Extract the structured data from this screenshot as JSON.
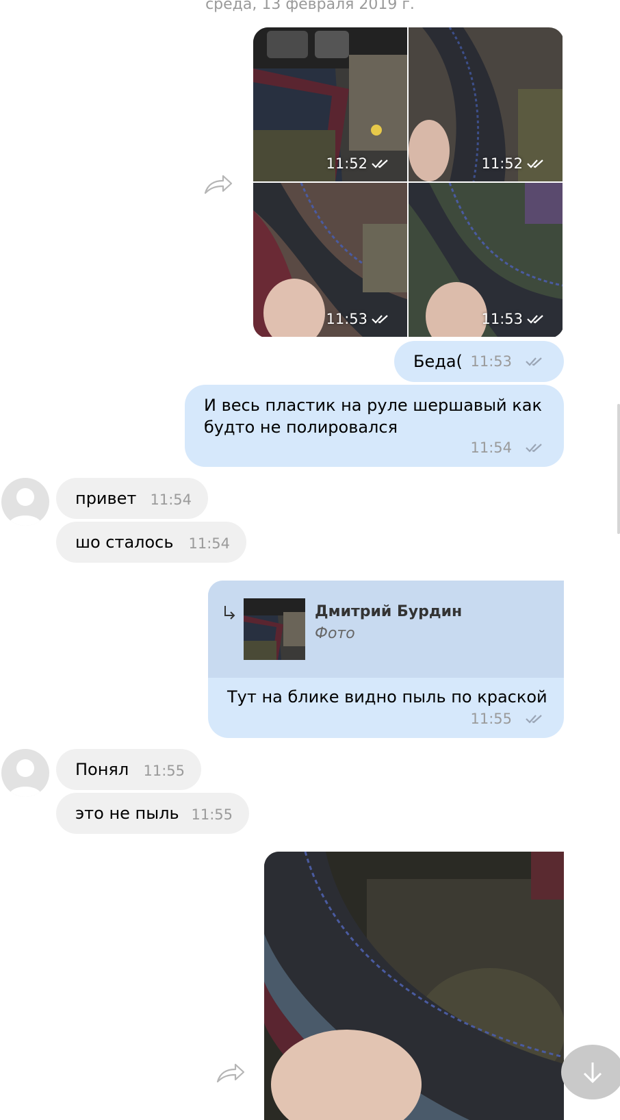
{
  "date_separator": "среда, 13 февраля 2019 г.",
  "photo_album": {
    "photos": [
      {
        "time": "11:52"
      },
      {
        "time": "11:52"
      },
      {
        "time": "11:53"
      },
      {
        "time": "11:53"
      }
    ]
  },
  "messages": {
    "beda": {
      "text": "Беда(",
      "time": "11:53"
    },
    "plastic": {
      "text_line1": "И весь пластик на руле шершавый как",
      "text_line2": "будто не полировался",
      "time": "11:54"
    },
    "privet": {
      "text": "привет",
      "time": "11:54"
    },
    "sho_stalos": {
      "text": "шо сталось",
      "time": "11:54"
    },
    "reply": {
      "author": "Дмитрий Бурдин",
      "attachment_type": "Фото",
      "text": "Тут на блике видно пыль по краской",
      "time": "11:55"
    },
    "ponyal": {
      "text": "Понял",
      "time": "11:55"
    },
    "ne_pyl": {
      "text": "это не пыль",
      "time": "11:55"
    }
  },
  "icons": {
    "share": "share-icon",
    "read_receipt": "double-check-icon",
    "reply_arrow": "reply-arrow-icon",
    "scroll_down": "arrow-down-icon",
    "avatar": "default-avatar-icon"
  },
  "colors": {
    "outgoing_bubble": "#d6e8fb",
    "incoming_bubble": "#f0f0f0",
    "reply_header": "#c8daf0",
    "timestamp": "#9a9a9a"
  }
}
